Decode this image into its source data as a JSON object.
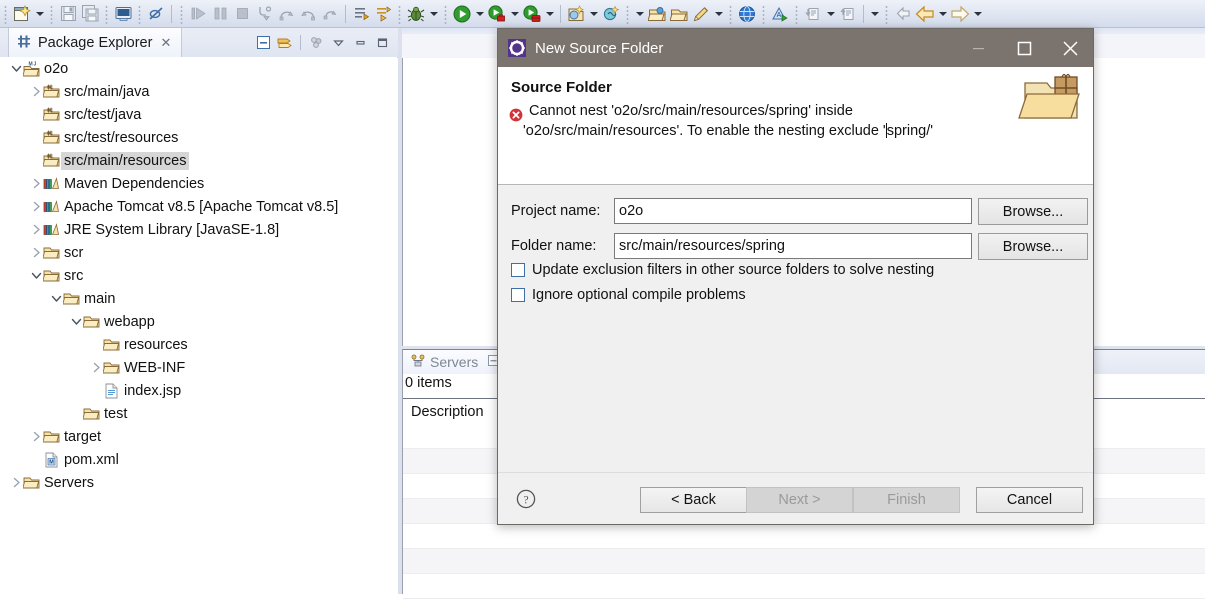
{
  "toolbar": {
    "items": [
      {
        "name": "new-wizard-icon",
        "type": "icon"
      },
      {
        "name": "new-wizard-dropdown-arrow",
        "type": "arrow"
      },
      {
        "name": "save-icon",
        "type": "icon"
      },
      {
        "name": "save-all-icon",
        "type": "icon"
      },
      {
        "name": "print-icon",
        "type": "icon"
      },
      {
        "name": "toggle-breakpoint-icon",
        "type": "icon"
      },
      {
        "name": "resume-icon",
        "type": "icon"
      },
      {
        "name": "suspend-icon",
        "type": "icon"
      },
      {
        "name": "terminate-icon",
        "type": "icon"
      },
      {
        "name": "step-into-icon",
        "type": "icon"
      },
      {
        "name": "step-over-icon",
        "type": "icon"
      },
      {
        "name": "step-return-icon",
        "type": "icon"
      },
      {
        "name": "drop-to-frame-icon",
        "type": "icon"
      },
      {
        "name": "next-annotation-icon",
        "type": "icon"
      },
      {
        "name": "previous-annotation-icon",
        "type": "icon"
      },
      {
        "name": "debug-bug-icon",
        "type": "icon"
      },
      {
        "name": "debug-dropdown-arrow",
        "type": "arrow"
      },
      {
        "name": "run-icon",
        "type": "icon"
      },
      {
        "name": "run-dropdown-arrow",
        "type": "arrow"
      },
      {
        "name": "run-server-icon",
        "type": "icon"
      },
      {
        "name": "run-server-dropdown-arrow",
        "type": "arrow"
      },
      {
        "name": "profile-icon",
        "type": "icon"
      },
      {
        "name": "profile-dropdown-arrow",
        "type": "arrow"
      },
      {
        "name": "new-java-package-icon",
        "type": "icon"
      },
      {
        "name": "new-java-package-dropdown-arrow",
        "type": "arrow"
      },
      {
        "name": "search-icon",
        "type": "icon"
      },
      {
        "name": "search-dropdown-arrow",
        "type": "arrow"
      },
      {
        "name": "open-task-icon",
        "type": "icon"
      },
      {
        "name": "open-folder-icon",
        "type": "icon"
      },
      {
        "name": "pencil-icon",
        "type": "icon"
      },
      {
        "name": "pencil-dropdown-arrow",
        "type": "arrow"
      },
      {
        "name": "web-browser-icon",
        "type": "icon"
      },
      {
        "name": "run-last-tool-icon",
        "type": "icon"
      },
      {
        "name": "previous-edit-icon",
        "type": "icon"
      },
      {
        "name": "previous-edit-dropdown-arrow",
        "type": "arrow"
      },
      {
        "name": "next-edit-icon",
        "type": "icon"
      },
      {
        "name": "next-edit-dropdown-arrow",
        "type": "arrow"
      },
      {
        "name": "back-small-icon",
        "type": "icon"
      },
      {
        "name": "back-icon",
        "type": "icon"
      },
      {
        "name": "back-dropdown-arrow",
        "type": "arrow"
      },
      {
        "name": "forward-icon",
        "type": "icon"
      },
      {
        "name": "forward-dropdown-arrow",
        "type": "arrow"
      }
    ]
  },
  "package_explorer": {
    "tab_title": "Package Explorer",
    "close_glyph": "✕",
    "tools": [
      "collapse-all-icon",
      "link-with-editor-icon",
      "view-menu-icon",
      "minimize-icon",
      "maximize-icon"
    ],
    "tree": [
      {
        "label": "o2o",
        "indent": 0,
        "twisty": "open",
        "icon": "maven-project-icon",
        "selected": false
      },
      {
        "label": "src/main/java",
        "indent": 1,
        "twisty": "closed",
        "icon": "source-folder-icon",
        "selected": false
      },
      {
        "label": "src/test/java",
        "indent": 1,
        "twisty": "none",
        "icon": "source-folder-icon",
        "selected": false
      },
      {
        "label": "src/test/resources",
        "indent": 1,
        "twisty": "none",
        "icon": "source-folder-icon",
        "selected": false
      },
      {
        "label": "src/main/resources",
        "indent": 1,
        "twisty": "none",
        "icon": "source-folder-icon",
        "selected": true
      },
      {
        "label": "Maven Dependencies",
        "indent": 1,
        "twisty": "closed",
        "icon": "library-icon",
        "selected": false
      },
      {
        "label": "Apache Tomcat v8.5 [Apache Tomcat v8.5]",
        "indent": 1,
        "twisty": "closed",
        "icon": "library-icon",
        "selected": false
      },
      {
        "label": "JRE System Library ",
        "dim": "[JavaSE-1.8]",
        "indent": 1,
        "twisty": "closed",
        "icon": "library-icon",
        "selected": false
      },
      {
        "label": "scr",
        "indent": 1,
        "twisty": "closed",
        "icon": "folder-icon",
        "selected": false
      },
      {
        "label": "src",
        "indent": 1,
        "twisty": "open",
        "icon": "folder-icon",
        "selected": false
      },
      {
        "label": "main",
        "indent": 2,
        "twisty": "open",
        "icon": "folder-icon",
        "selected": false
      },
      {
        "label": "webapp",
        "indent": 3,
        "twisty": "open",
        "icon": "folder-icon",
        "selected": false
      },
      {
        "label": "resources",
        "indent": 4,
        "twisty": "none",
        "icon": "folder-icon",
        "selected": false
      },
      {
        "label": "WEB-INF",
        "indent": 4,
        "twisty": "closed",
        "icon": "folder-icon",
        "selected": false
      },
      {
        "label": "index.jsp",
        "indent": 4,
        "twisty": "none",
        "icon": "jsp-file-icon",
        "selected": false
      },
      {
        "label": "test",
        "indent": 3,
        "twisty": "none",
        "icon": "folder-icon",
        "selected": false
      },
      {
        "label": "target",
        "indent": 1,
        "twisty": "closed",
        "icon": "folder-icon",
        "selected": false
      },
      {
        "label": "pom.xml",
        "indent": 1,
        "twisty": "none",
        "icon": "pom-file-icon",
        "selected": false
      },
      {
        "label": "Servers",
        "indent": 0,
        "twisty": "closed",
        "icon": "folder-icon",
        "selected": false
      }
    ]
  },
  "servers_view": {
    "tab_title": "Servers",
    "item_count": "0 items",
    "column_header": "Description",
    "row_count": 7
  },
  "dialog": {
    "title": "New Source Folder",
    "title_icon": "eclipse-wizard-icon",
    "window_buttons": {
      "minimize": "minimize-icon",
      "maximize": "maximize-icon",
      "close": "close-icon"
    },
    "header": {
      "title": "Source Folder",
      "status_icon": "error-icon",
      "message_line1": "Cannot nest 'o2o/src/main/resources/spring' inside",
      "message_line2_a": "'o2o/src/main/resources'. To enable the nesting exclude '",
      "message_line2_b": "spring/'",
      "banner_icon": "source-folder-banner-icon"
    },
    "fields": [
      {
        "label": "Project name:",
        "value": "o2o",
        "placeholder": "",
        "browse_label": "Browse..."
      },
      {
        "label": "Folder name:",
        "value": "src/main/resources/spring",
        "placeholder": "",
        "browse_label": "Browse..."
      }
    ],
    "checkboxes": [
      {
        "label": "Update exclusion filters in other source folders to solve nesting",
        "checked": false
      },
      {
        "label": "Ignore optional compile problems",
        "checked": false
      }
    ],
    "footer": {
      "help_icon": "help-icon",
      "buttons": [
        {
          "label": "< Back",
          "enabled": true
        },
        {
          "label": "Next >",
          "enabled": false
        },
        {
          "label": "Finish",
          "enabled": false
        },
        {
          "label": "Cancel",
          "enabled": true
        }
      ]
    }
  },
  "colors": {
    "toolbar_bg": "#dfe5f1",
    "dialog_titlebar": "#7a736e",
    "dialog_bg": "#f0f0f0",
    "error_red": "#d13438",
    "selection_gray": "#d6d6d6",
    "library_version_text": "#9a8a5c",
    "folder_gold": "#e0b050"
  }
}
